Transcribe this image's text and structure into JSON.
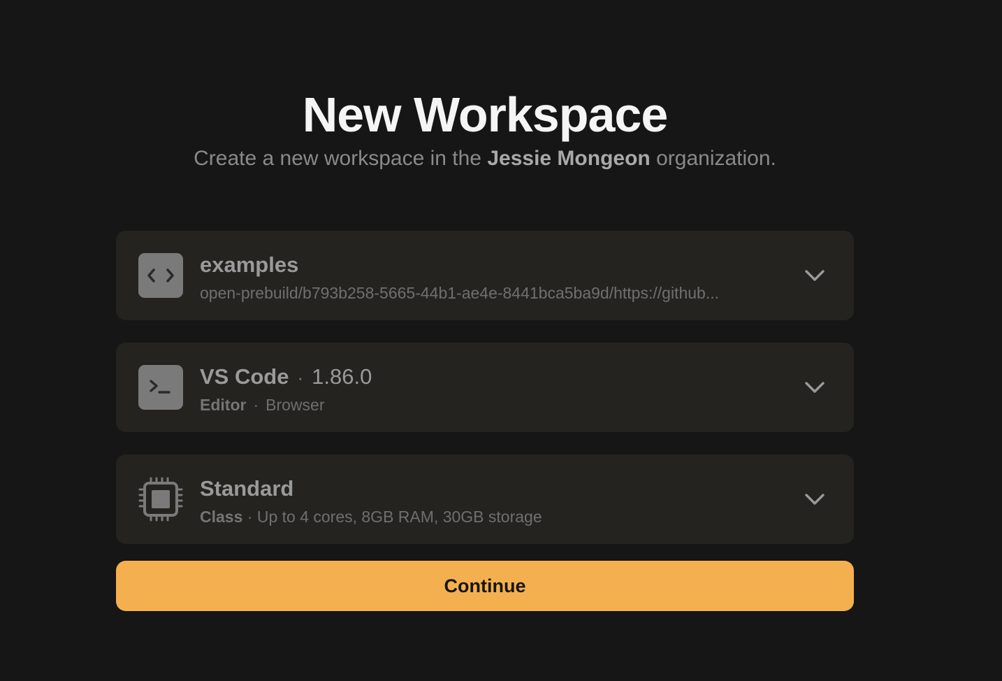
{
  "header": {
    "title": "New Workspace",
    "subtitle_prefix": "Create a new workspace in the ",
    "organization": "Jessie Mongeon",
    "subtitle_suffix": " organization."
  },
  "cards": {
    "context": {
      "icon": "code-brackets-icon",
      "title": "examples",
      "subtitle": "open-prebuild/b793b258-5665-44b1-ae4e-8441bca5ba9d/https://github..."
    },
    "editor": {
      "icon": "terminal-icon",
      "name": "VS Code",
      "separator": "·",
      "version": "1.86.0",
      "type_label": "Editor",
      "sub_separator": "·",
      "mode": "Browser"
    },
    "machine": {
      "icon": "cpu-chip-icon",
      "title": "Standard",
      "class_label": "Class",
      "sub_separator": "·",
      "spec": "Up to 4 cores, 8GB RAM, 30GB storage"
    }
  },
  "actions": {
    "continue_label": "Continue"
  },
  "colors": {
    "background": "#161616",
    "card": "#242320",
    "accent": "#f4b04f"
  }
}
